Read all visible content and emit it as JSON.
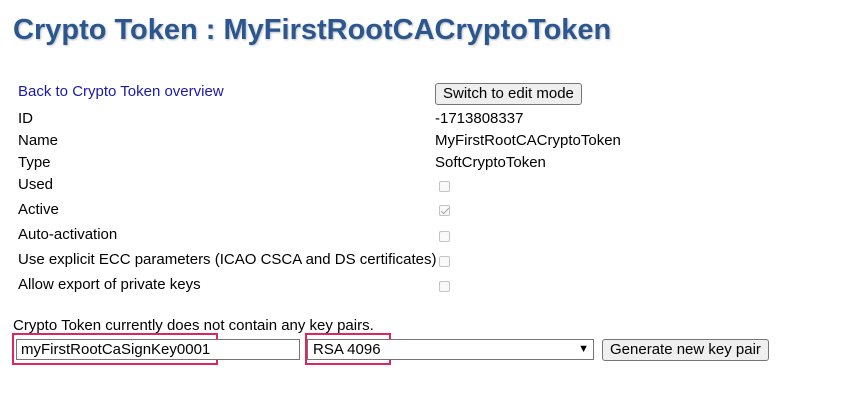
{
  "page": {
    "title": "Crypto Token : MyFirstRootCACryptoToken"
  },
  "nav": {
    "back_link": "Back to Crypto Token overview"
  },
  "toolbar": {
    "edit_mode_label": "Switch to edit mode"
  },
  "properties": [
    {
      "label": "ID",
      "value": "-1713808337"
    },
    {
      "label": "Name",
      "value": "MyFirstRootCACryptoToken"
    },
    {
      "label": "Type",
      "value": "SoftCryptoToken"
    }
  ],
  "flags": [
    {
      "label": "Used",
      "checked": false
    },
    {
      "label": "Active",
      "checked": true
    },
    {
      "label": "Auto-activation",
      "checked": false
    },
    {
      "label": "Use explicit ECC parameters (ICAO CSCA and DS certificates)",
      "checked": false
    },
    {
      "label": "Allow export of private keys",
      "checked": false
    }
  ],
  "keys": {
    "status": "Crypto Token currently does not contain any key pairs.",
    "alias_value": "myFirstRootCaSignKey0001",
    "algorithm_selected": "RSA 4096",
    "generate_label": "Generate new key pair"
  },
  "colors": {
    "title": "#2b5690",
    "link": "#1a1aa6",
    "highlight": "#e0245e"
  }
}
